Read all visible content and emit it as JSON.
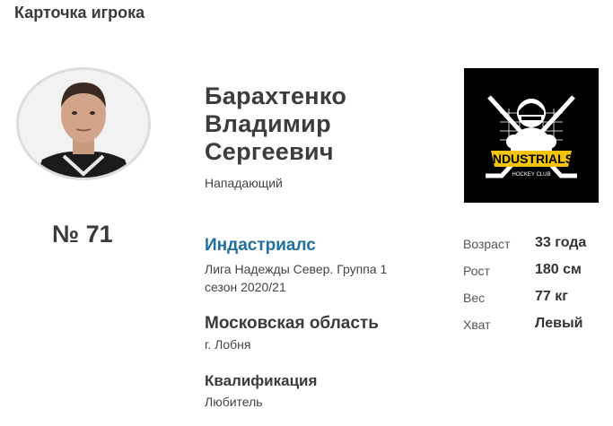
{
  "page": {
    "title": "Карточка игрока"
  },
  "player": {
    "number": "№ 71",
    "name_lines": [
      "Барахтенко",
      "Владимир",
      "Сергеевич"
    ],
    "position": "Нападающий"
  },
  "team": {
    "name": "Индастриалс",
    "league": "Лига Надежды Север. Группа 1",
    "season": "сезон 2020/21"
  },
  "region": {
    "name": "Московская область",
    "city": "г. Лобня"
  },
  "qualification": {
    "title": "Квалификация",
    "value": "Любитель"
  },
  "logo": {
    "icon": "hockey-club-logo",
    "main_text": "INDUSTRIALS",
    "sub_text": "HOCKEY CLUB",
    "colors": {
      "background": "#000000",
      "accent": "#f2c40f"
    }
  },
  "stats": [
    {
      "label": "Возраст",
      "value": "33 года"
    },
    {
      "label": "Рост",
      "value": "180 см"
    },
    {
      "label": "Вес",
      "value": "77 кг"
    },
    {
      "label": "Хват",
      "value": "Левый"
    }
  ],
  "colors": {
    "link": "#1f6f9f",
    "avatar_border": "#d9dde2"
  }
}
